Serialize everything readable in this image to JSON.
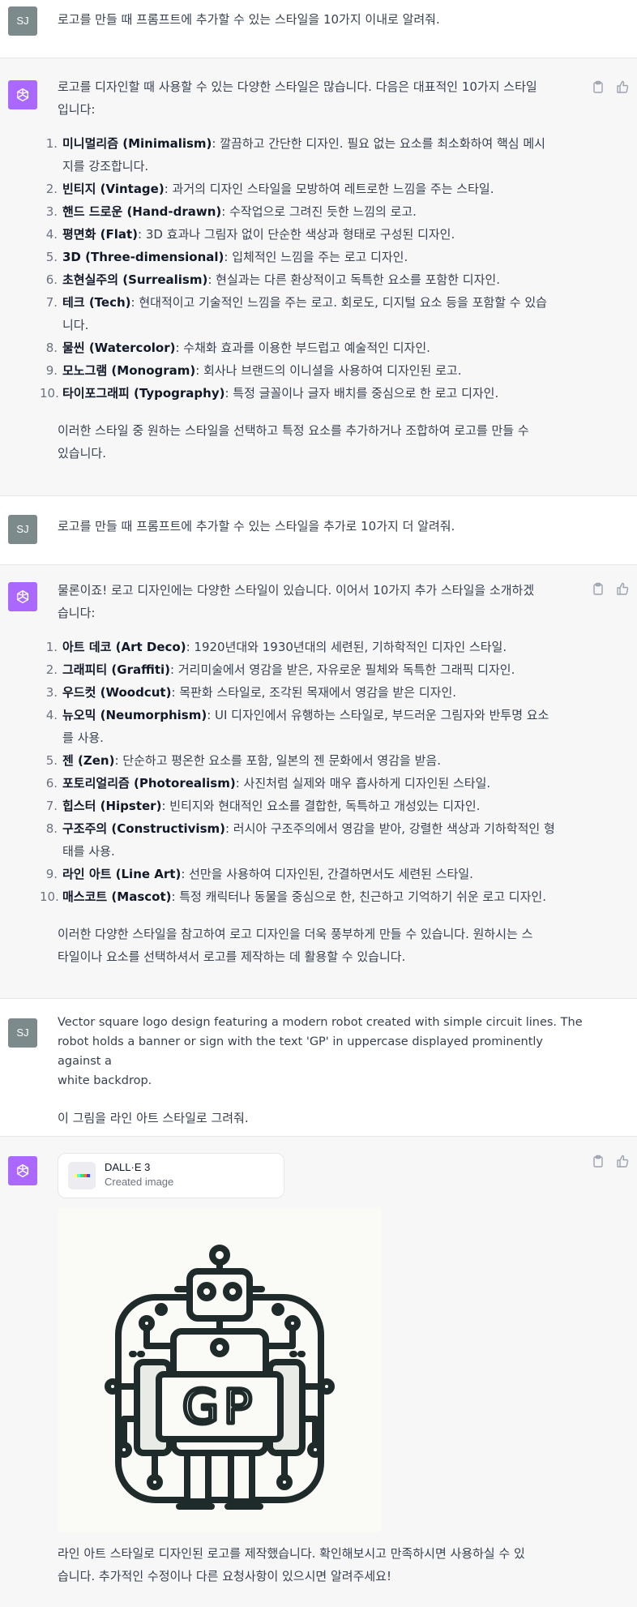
{
  "user_avatar": "SJ",
  "icons": {
    "assistant": "openai-logo-icon",
    "copy": "clipboard-icon",
    "like": "thumbs-up-icon"
  },
  "colors": {
    "assistant_avatar": "#ab68ff",
    "user_avatar": "#7d8a8c",
    "assistant_bg": "#f7f7f8"
  },
  "turns": [
    {
      "role": "user",
      "text": "로고를 만들 때 프롬프트에 추가할 수 있는 스타일을 10가지 이내로 알려줘."
    },
    {
      "role": "assistant",
      "intro": [
        "로고를 디자인할 때 사용할 수 있는 다양한 스타일은 많습니다. 다음은 대표적인 10가지 스타일",
        "입니다:"
      ],
      "items": [
        {
          "n": "1.",
          "name": "미니멀리즘 (Minimalism)",
          "desc": ": 깔끔하고 간단한 디자인. 필요 없는 요소를 최소화하여 핵심 메시",
          "desc2": "지를 강조합니다."
        },
        {
          "n": "2.",
          "name": "빈티지 (Vintage)",
          "desc": ": 과거의 디자인 스타일을 모방하여 레트로한 느낌을 주는 스타일."
        },
        {
          "n": "3.",
          "name": "핸드 드로운 (Hand-drawn)",
          "desc": ": 수작업으로 그려진 듯한 느낌의 로고."
        },
        {
          "n": "4.",
          "name": "평면화 (Flat)",
          "desc": ": 3D 효과나 그림자 없이 단순한 색상과 형태로 구성된 디자인."
        },
        {
          "n": "5.",
          "name": "3D (Three-dimensional)",
          "desc": ": 입체적인 느낌을 주는 로고 디자인."
        },
        {
          "n": "6.",
          "name": "초현실주의 (Surrealism)",
          "desc": ": 현실과는 다른 환상적이고 독특한 요소를 포함한 디자인."
        },
        {
          "n": "7.",
          "name": "테크 (Tech)",
          "desc": ": 현대적이고 기술적인 느낌을 주는 로고. 회로도, 디지털 요소 등을 포함할 수 있습",
          "desc2": "니다."
        },
        {
          "n": "8.",
          "name": "물씬 (Watercolor)",
          "desc": ": 수채화 효과를 이용한 부드럽고 예술적인 디자인."
        },
        {
          "n": "9.",
          "name": "모노그램 (Monogram)",
          "desc": ": 회사나 브랜드의 이니셜을 사용하여 디자인된 로고."
        },
        {
          "n": "10.",
          "name": "타이포그래피 (Typography)",
          "desc": ": 특정 글꼴이나 글자 배치를 중심으로 한 로고 디자인."
        }
      ],
      "outro": [
        "이러한 스타일 중 원하는 스타일을 선택하고 특정 요소를 추가하거나 조합하여 로고를 만들 수",
        "있습니다."
      ]
    },
    {
      "role": "user",
      "text": "로고를 만들 때 프롬프트에 추가할 수 있는 스타일을 추가로 10가지 더 알려줘."
    },
    {
      "role": "assistant",
      "intro": [
        "물론이죠! 로고 디자인에는 다양한 스타일이 있습니다. 이어서 10가지 추가 스타일을 소개하겠",
        "습니다:"
      ],
      "items": [
        {
          "n": "1.",
          "name": "아트 데코 (Art Deco)",
          "desc": ": 1920년대와 1930년대의 세련된, 기하학적인 디자인 스타일."
        },
        {
          "n": "2.",
          "name": "그래피티 (Graffiti)",
          "desc": ": 거리미술에서 영감을 받은, 자유로운 필체와 독특한 그래픽 디자인."
        },
        {
          "n": "3.",
          "name": "우드컷 (Woodcut)",
          "desc": ": 목판화 스타일로, 조각된 목재에서 영감을 받은 디자인."
        },
        {
          "n": "4.",
          "name": "뉴오믹 (Neumorphism)",
          "desc": ": UI 디자인에서 유행하는 스타일로, 부드러운 그림자와 반투명 요소",
          "desc2": "를 사용."
        },
        {
          "n": "5.",
          "name": "젠 (Zen)",
          "desc": ": 단순하고 평온한 요소를 포함, 일본의 젠 문화에서 영감을 받음."
        },
        {
          "n": "6.",
          "name": "포토리얼리즘 (Photorealism)",
          "desc": ": 사진처럼 실제와 매우 흡사하게 디자인된 스타일."
        },
        {
          "n": "7.",
          "name": "힙스터 (Hipster)",
          "desc": ": 빈티지와 현대적인 요소를 결합한, 독특하고 개성있는 디자인."
        },
        {
          "n": "8.",
          "name": "구조주의 (Constructivism)",
          "desc": ": 러시아 구조주의에서 영감을 받아, 강렬한 색상과 기하학적인 형",
          "desc2": "태를 사용."
        },
        {
          "n": "9.",
          "name": "라인 아트 (Line Art)",
          "desc": ": 선만을 사용하여 디자인된, 간결하면서도 세련된 스타일."
        },
        {
          "n": "10.",
          "name": "매스코트 (Mascot)",
          "desc": ": 특정 캐릭터나 동물을 중심으로 한, 친근하고 기억하기 쉬운 로고 디자인."
        }
      ],
      "outro": [
        "이러한 다양한 스타일을 참고하여 로고 디자인을 더욱 풍부하게 만들 수 있습니다. 원하시는 스",
        "타일이나 요소를 선택하셔서 로고를 제작하는 데 활용할 수 있습니다."
      ]
    },
    {
      "role": "user",
      "lines": [
        "Vector square logo design featuring a modern robot created with simple circuit lines. The",
        "robot holds a banner or sign with the text 'GP' in uppercase displayed prominently against a",
        "white backdrop."
      ],
      "text2": "이 그림을 라인 아트 스타일로 그려줘."
    },
    {
      "role": "assistant",
      "dalle": {
        "title": "DALL·E 3",
        "subtitle": "Created image",
        "image_text": "GP"
      },
      "outro": [
        "라인 아트 스타일로 디자인된 로고를 제작했습니다. 확인해보시고 만족하시면 사용하실 수 있",
        "습니다. 추가적인 수정이나 다른 요청사항이 있으시면 알려주세요!"
      ]
    }
  ]
}
